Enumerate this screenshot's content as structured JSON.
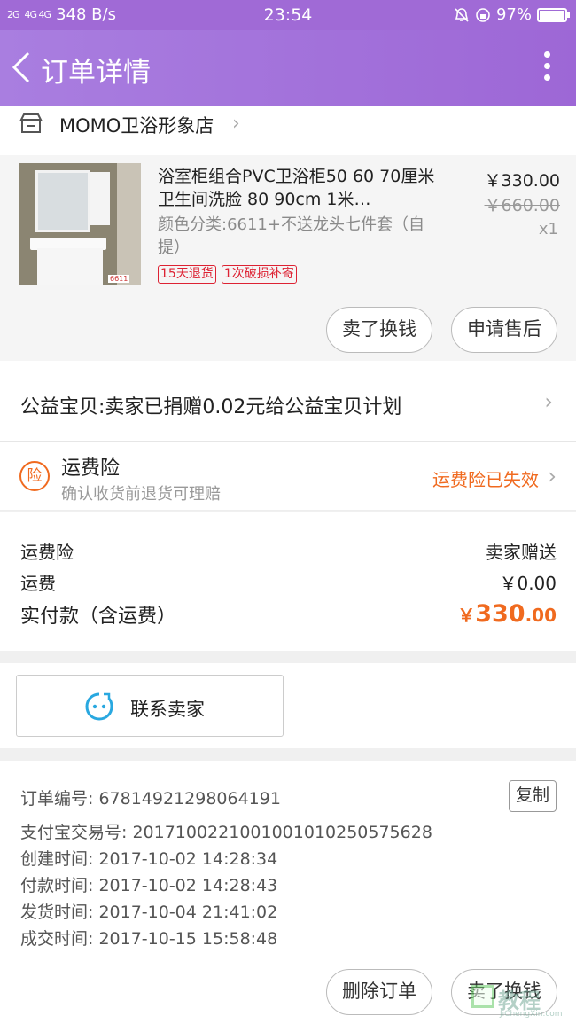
{
  "status_bar": {
    "signal_1": "2G",
    "signal_2": "4G 4G",
    "speed": "348 B/s",
    "time": "23:54",
    "battery": "97%",
    "battery_level": 0.97
  },
  "header": {
    "title": "订单详情"
  },
  "shop": {
    "name": "MOMO卫浴形象店"
  },
  "product": {
    "title": "浴室柜组合PVC卫浴柜50 60 70厘米卫生间洗脸  80 90cm 1米…",
    "sku": "颜色分类:6611+不送龙头七件套（自提）",
    "tags": [
      "15天退货",
      "1次破损补寄"
    ],
    "price": "￥330.00",
    "original_price": "￥660.00",
    "quantity": "x1",
    "image_tag": "6611",
    "actions": {
      "sell_button": "卖了换钱",
      "aftersale_button": "申请售后"
    }
  },
  "charity": {
    "text": "公益宝贝:卖家已捐赠0.02元给公益宝贝计划"
  },
  "insurance": {
    "badge": "险",
    "title": "运费险",
    "subtitle": "确认收货前退货可理赔",
    "status": "运费险已失效"
  },
  "totals": {
    "insurance_label": "运费险",
    "insurance_value": "卖家赠送",
    "shipping_label": "运费",
    "shipping_value": "￥0.00",
    "paid_label": "实付款（含运费）",
    "paid_currency": "￥",
    "paid_integer": "330",
    "paid_decimal": ".00"
  },
  "contact": {
    "label": "联系卖家"
  },
  "order_info": {
    "order_no": "订单编号: 67814921298064191",
    "alipay_no": "支付宝交易号: 2017100221001001010250575628",
    "created": "创建时间: 2017-10-02 14:28:34",
    "paid": "付款时间: 2017-10-02 14:28:43",
    "shipped": "发货时间: 2017-10-04 21:41:02",
    "completed": "成交时间: 2017-10-15 15:58:48",
    "copy_button": "复制"
  },
  "bottom_actions": {
    "delete_button": "删除订单",
    "sell_button": "卖了换钱"
  },
  "watermark": {
    "text": "教程",
    "sub": "JiChengXin.com"
  },
  "colors": {
    "header": "#a06ad6",
    "accent": "#f06a1f",
    "tag_red": "#d22233",
    "contact_icon": "#29a8e0"
  }
}
